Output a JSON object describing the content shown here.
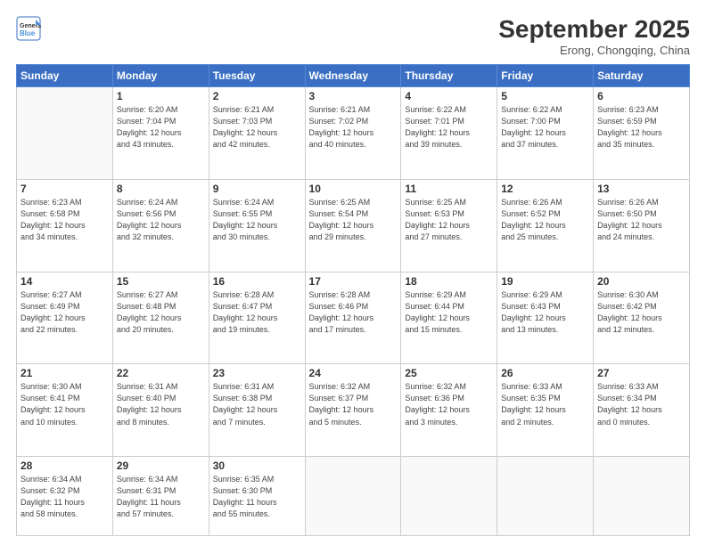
{
  "logo": {
    "line1": "General",
    "line2": "Blue"
  },
  "title": "September 2025",
  "subtitle": "Erong, Chongqing, China",
  "weekdays": [
    "Sunday",
    "Monday",
    "Tuesday",
    "Wednesday",
    "Thursday",
    "Friday",
    "Saturday"
  ],
  "weeks": [
    [
      {
        "day": "",
        "detail": ""
      },
      {
        "day": "1",
        "detail": "Sunrise: 6:20 AM\nSunset: 7:04 PM\nDaylight: 12 hours\nand 43 minutes."
      },
      {
        "day": "2",
        "detail": "Sunrise: 6:21 AM\nSunset: 7:03 PM\nDaylight: 12 hours\nand 42 minutes."
      },
      {
        "day": "3",
        "detail": "Sunrise: 6:21 AM\nSunset: 7:02 PM\nDaylight: 12 hours\nand 40 minutes."
      },
      {
        "day": "4",
        "detail": "Sunrise: 6:22 AM\nSunset: 7:01 PM\nDaylight: 12 hours\nand 39 minutes."
      },
      {
        "day": "5",
        "detail": "Sunrise: 6:22 AM\nSunset: 7:00 PM\nDaylight: 12 hours\nand 37 minutes."
      },
      {
        "day": "6",
        "detail": "Sunrise: 6:23 AM\nSunset: 6:59 PM\nDaylight: 12 hours\nand 35 minutes."
      }
    ],
    [
      {
        "day": "7",
        "detail": "Sunrise: 6:23 AM\nSunset: 6:58 PM\nDaylight: 12 hours\nand 34 minutes."
      },
      {
        "day": "8",
        "detail": "Sunrise: 6:24 AM\nSunset: 6:56 PM\nDaylight: 12 hours\nand 32 minutes."
      },
      {
        "day": "9",
        "detail": "Sunrise: 6:24 AM\nSunset: 6:55 PM\nDaylight: 12 hours\nand 30 minutes."
      },
      {
        "day": "10",
        "detail": "Sunrise: 6:25 AM\nSunset: 6:54 PM\nDaylight: 12 hours\nand 29 minutes."
      },
      {
        "day": "11",
        "detail": "Sunrise: 6:25 AM\nSunset: 6:53 PM\nDaylight: 12 hours\nand 27 minutes."
      },
      {
        "day": "12",
        "detail": "Sunrise: 6:26 AM\nSunset: 6:52 PM\nDaylight: 12 hours\nand 25 minutes."
      },
      {
        "day": "13",
        "detail": "Sunrise: 6:26 AM\nSunset: 6:50 PM\nDaylight: 12 hours\nand 24 minutes."
      }
    ],
    [
      {
        "day": "14",
        "detail": "Sunrise: 6:27 AM\nSunset: 6:49 PM\nDaylight: 12 hours\nand 22 minutes."
      },
      {
        "day": "15",
        "detail": "Sunrise: 6:27 AM\nSunset: 6:48 PM\nDaylight: 12 hours\nand 20 minutes."
      },
      {
        "day": "16",
        "detail": "Sunrise: 6:28 AM\nSunset: 6:47 PM\nDaylight: 12 hours\nand 19 minutes."
      },
      {
        "day": "17",
        "detail": "Sunrise: 6:28 AM\nSunset: 6:46 PM\nDaylight: 12 hours\nand 17 minutes."
      },
      {
        "day": "18",
        "detail": "Sunrise: 6:29 AM\nSunset: 6:44 PM\nDaylight: 12 hours\nand 15 minutes."
      },
      {
        "day": "19",
        "detail": "Sunrise: 6:29 AM\nSunset: 6:43 PM\nDaylight: 12 hours\nand 13 minutes."
      },
      {
        "day": "20",
        "detail": "Sunrise: 6:30 AM\nSunset: 6:42 PM\nDaylight: 12 hours\nand 12 minutes."
      }
    ],
    [
      {
        "day": "21",
        "detail": "Sunrise: 6:30 AM\nSunset: 6:41 PM\nDaylight: 12 hours\nand 10 minutes."
      },
      {
        "day": "22",
        "detail": "Sunrise: 6:31 AM\nSunset: 6:40 PM\nDaylight: 12 hours\nand 8 minutes."
      },
      {
        "day": "23",
        "detail": "Sunrise: 6:31 AM\nSunset: 6:38 PM\nDaylight: 12 hours\nand 7 minutes."
      },
      {
        "day": "24",
        "detail": "Sunrise: 6:32 AM\nSunset: 6:37 PM\nDaylight: 12 hours\nand 5 minutes."
      },
      {
        "day": "25",
        "detail": "Sunrise: 6:32 AM\nSunset: 6:36 PM\nDaylight: 12 hours\nand 3 minutes."
      },
      {
        "day": "26",
        "detail": "Sunrise: 6:33 AM\nSunset: 6:35 PM\nDaylight: 12 hours\nand 2 minutes."
      },
      {
        "day": "27",
        "detail": "Sunrise: 6:33 AM\nSunset: 6:34 PM\nDaylight: 12 hours\nand 0 minutes."
      }
    ],
    [
      {
        "day": "28",
        "detail": "Sunrise: 6:34 AM\nSunset: 6:32 PM\nDaylight: 11 hours\nand 58 minutes."
      },
      {
        "day": "29",
        "detail": "Sunrise: 6:34 AM\nSunset: 6:31 PM\nDaylight: 11 hours\nand 57 minutes."
      },
      {
        "day": "30",
        "detail": "Sunrise: 6:35 AM\nSunset: 6:30 PM\nDaylight: 11 hours\nand 55 minutes."
      },
      {
        "day": "",
        "detail": ""
      },
      {
        "day": "",
        "detail": ""
      },
      {
        "day": "",
        "detail": ""
      },
      {
        "day": "",
        "detail": ""
      }
    ]
  ]
}
